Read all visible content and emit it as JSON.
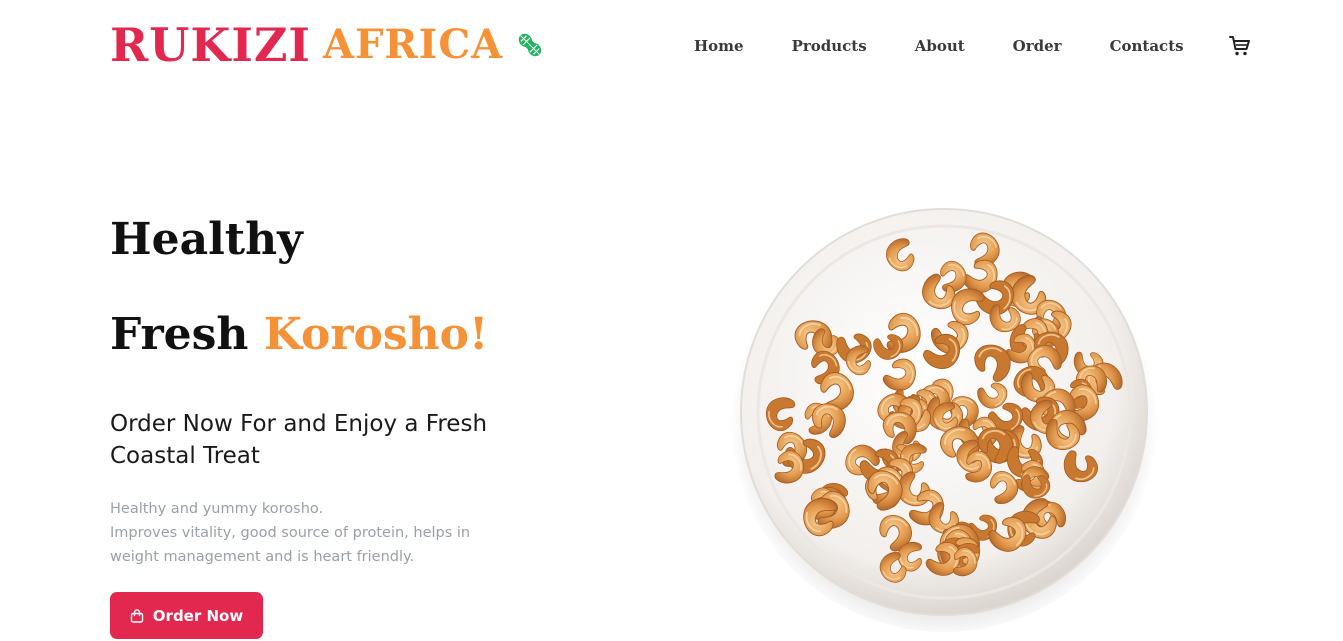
{
  "brand": {
    "name_part1": "RUKIZI",
    "name_part2": "AFRICA",
    "primary_color": "#e2284f",
    "accent_color": "#f59238",
    "logo_icon": "peanut-icon",
    "logo_icon_color": "#1fb55c"
  },
  "nav": {
    "items": [
      {
        "label": "Home"
      },
      {
        "label": "Products"
      },
      {
        "label": "About"
      },
      {
        "label": "Order"
      },
      {
        "label": "Contacts"
      }
    ],
    "cart_icon": "cart-icon"
  },
  "hero": {
    "title_line1": "Healthy",
    "title_line2_plain": "Fresh",
    "title_line2_accent": "Korosho!",
    "subtitle": "Order Now For and Enjoy a Fresh Coastal Treat",
    "description_line1": "Healthy and yummy korosho.",
    "description_line2": "Improves vitality, good source of protein, helps in weight management and is heart friendly.",
    "cta_label": "Order Now",
    "cta_icon": "shopping-bag-icon",
    "image": "cashew-plate-image"
  }
}
